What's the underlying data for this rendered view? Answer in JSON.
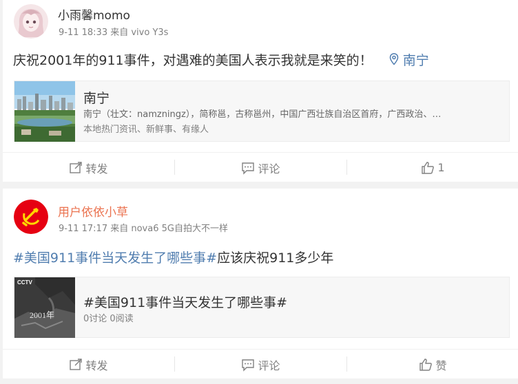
{
  "posts": [
    {
      "username": "小雨馨momo",
      "meta": "9-11 18:33 来自 vivo Y3s",
      "text": "庆祝2001年的911事件，对遇难的美国人表示我就是来笑的！",
      "location": "南宁",
      "link_card": {
        "title": "南宁",
        "desc": "南宁（壮文：namzningz），简称邕，古称邕州，中国广西壮族自治区首府，广西政治、…",
        "sub": "本地热门资讯、新鲜事、有缘人"
      },
      "actions": {
        "repost": "转发",
        "comment": "评论",
        "like": "1"
      }
    },
    {
      "username": "用户依依小草",
      "meta": "9-11 17:17 来自 nova6 5G自拍大不一样",
      "hashtag": "#美国911事件当天发生了哪些事#",
      "text": "应该庆祝911多少年",
      "link_card": {
        "title": "#美国911事件当天发生了哪些事#",
        "sub": "0讨论 0阅读",
        "thumb_logo": "CCTV",
        "thumb_text": "2001年"
      },
      "actions": {
        "repost": "转发",
        "comment": "评论",
        "like": "赞"
      }
    }
  ],
  "colors": {
    "link": "#507daf",
    "username_highlight": "#eb7350",
    "meta": "#808080"
  }
}
